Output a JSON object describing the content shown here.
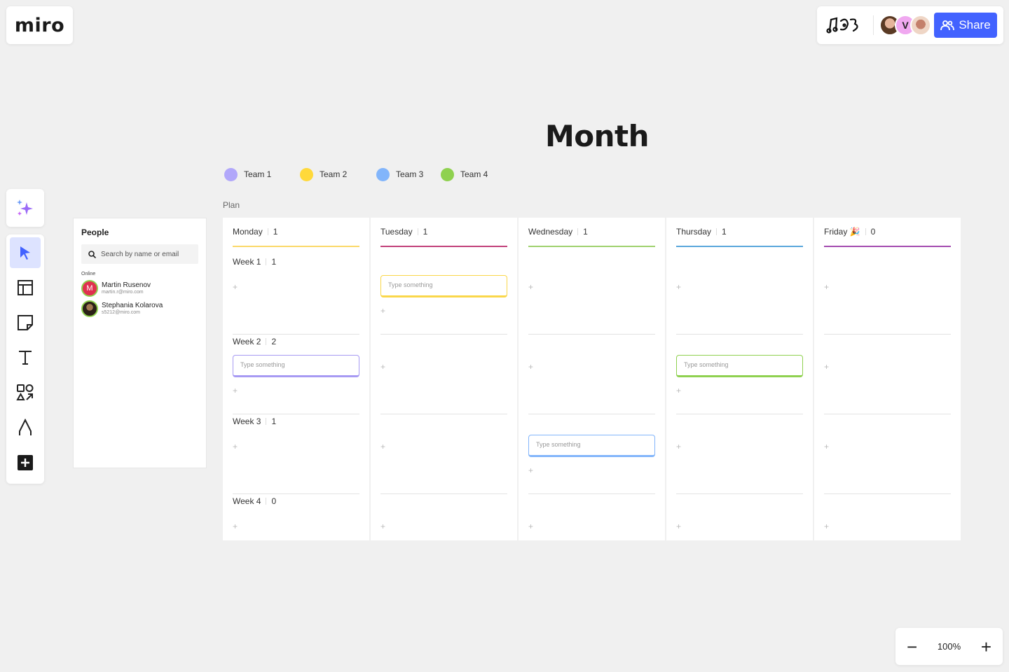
{
  "app": {
    "logo": "miro",
    "zoom_level": "100%",
    "share_label": "Share",
    "collaborators": [
      {
        "name": "collaborator-1",
        "initial": ""
      },
      {
        "name": "collaborator-2",
        "initial": "V"
      },
      {
        "name": "collaborator-3",
        "initial": ""
      }
    ]
  },
  "toolbar": {
    "tools": [
      {
        "name": "ai-sparkle",
        "active": false
      },
      {
        "name": "select",
        "active": true
      },
      {
        "name": "templates",
        "active": false
      },
      {
        "name": "sticky-note",
        "active": false
      },
      {
        "name": "text",
        "active": false
      },
      {
        "name": "shapes",
        "active": false
      },
      {
        "name": "pen",
        "active": false
      },
      {
        "name": "more-apps",
        "active": false
      }
    ]
  },
  "people_panel": {
    "title": "People",
    "search_placeholder": "Search by name or email",
    "section_label": "Online",
    "people": [
      {
        "name": "Martin Rusenov",
        "email": "martin.r@miro.com",
        "initial": "M",
        "color": "#e0304f"
      },
      {
        "name": "Stephania Kolarova",
        "email": "s5212@miro.com",
        "initial": "",
        "color": "#3a2b1e"
      }
    ]
  },
  "board": {
    "title": "Month",
    "plan_label": "Plan",
    "teams": [
      {
        "label": "Team 1",
        "color": "#b1a7fa"
      },
      {
        "label": "Team 2",
        "color": "#ffd93b"
      },
      {
        "label": "Team 3",
        "color": "#82b5fb"
      },
      {
        "label": "Team 4",
        "color": "#8fd14f"
      }
    ],
    "weeks": [
      {
        "label": "Week 1",
        "count": "1"
      },
      {
        "label": "Week 2",
        "count": "2"
      },
      {
        "label": "Week 3",
        "count": "1"
      },
      {
        "label": "Week 4",
        "count": "0"
      }
    ],
    "columns": [
      {
        "label": "Monday",
        "count": "1",
        "line_color": "#fbd969"
      },
      {
        "label": "Tuesday",
        "count": "1",
        "line_color": "#c2417a"
      },
      {
        "label": "Wednesday",
        "count": "1",
        "line_color": "#9fd16f"
      },
      {
        "label": "Thursday",
        "count": "1",
        "line_color": "#5aa7dc"
      },
      {
        "label": "Friday 🎉",
        "count": "0",
        "line_color": "#a44cb0"
      }
    ],
    "plus_label": "+",
    "cards": [
      {
        "column": 0,
        "week": 1,
        "placeholder": "Type something",
        "color": "#a79af3"
      },
      {
        "column": 1,
        "week": 0,
        "placeholder": "Type something",
        "color": "#fad74a"
      },
      {
        "column": 2,
        "week": 2,
        "placeholder": "Type something",
        "color": "#82b5fb"
      },
      {
        "column": 3,
        "week": 1,
        "placeholder": "Type something",
        "color": "#8fd14f"
      }
    ]
  }
}
